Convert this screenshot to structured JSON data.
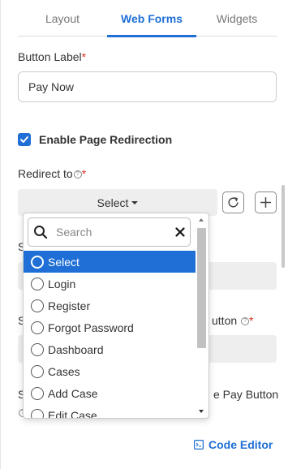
{
  "tabs": [
    {
      "label": "Layout"
    },
    {
      "label": "Web Forms"
    },
    {
      "label": "Widgets"
    }
  ],
  "button_label": {
    "label": "Button Label",
    "required_mark": "*",
    "value": "Pay Now"
  },
  "redirection": {
    "checkbox_label": "Enable Page Redirection",
    "checked": true
  },
  "redirect_to": {
    "label": "Redirect to",
    "required_mark": "*",
    "selected": "Select"
  },
  "background": {
    "s_letter_1": "S",
    "s_letter_2": "S",
    "button_fragment": "utton",
    "required_mark": "*",
    "s_letter_3": "S",
    "pay_button_fragment": "e Pay Button"
  },
  "dropdown": {
    "search_placeholder": "Search",
    "options": [
      {
        "label": "Select",
        "selected": true
      },
      {
        "label": "Login"
      },
      {
        "label": "Register"
      },
      {
        "label": "Forgot Password"
      },
      {
        "label": "Dashboard"
      },
      {
        "label": "Cases"
      },
      {
        "label": "Add Case"
      },
      {
        "label": "Edit Case"
      }
    ]
  },
  "code_editor": {
    "label": "Code Editor"
  },
  "colors": {
    "accent": "#1f6fd6",
    "required": "#d93025"
  }
}
